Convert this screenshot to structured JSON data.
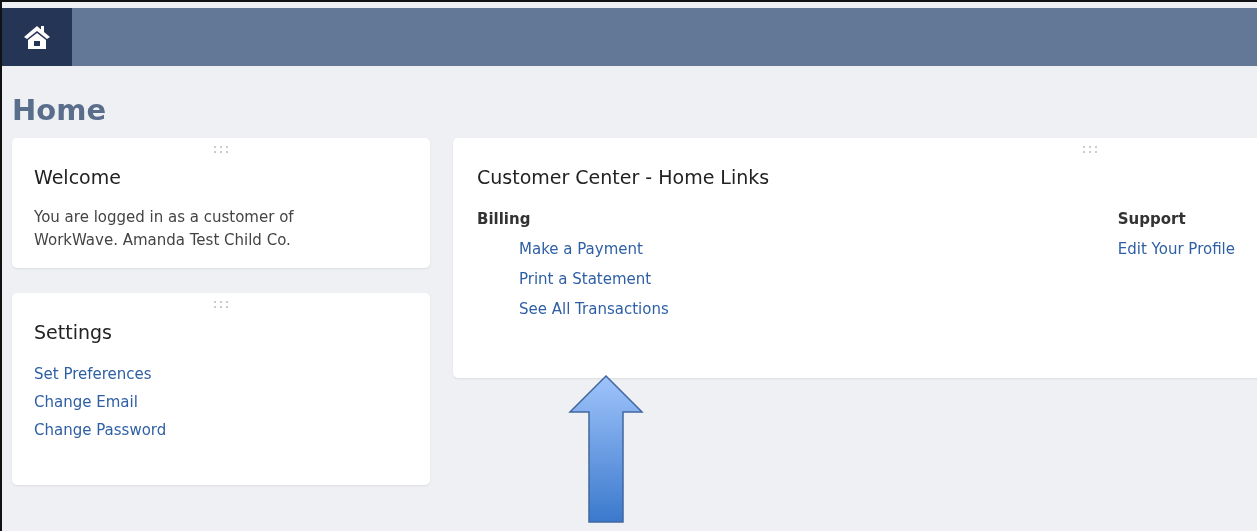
{
  "page_title": "Home",
  "left_cards": [
    {
      "kind": "text",
      "title": "Welcome",
      "text": "You are logged in as a customer of WorkWave. Amanda Test Child Co."
    },
    {
      "kind": "links",
      "title": "Settings",
      "links": [
        "Set Preferences",
        "Change Email",
        "Change Password"
      ]
    }
  ],
  "links_card": {
    "title": "Customer Center - Home Links",
    "sections": [
      {
        "heading": "Billing",
        "links": [
          "Make a Payment",
          "Print a Statement",
          "See All Transactions"
        ]
      },
      {
        "heading": "Support",
        "links": [
          "Edit Your Profile"
        ]
      }
    ]
  }
}
